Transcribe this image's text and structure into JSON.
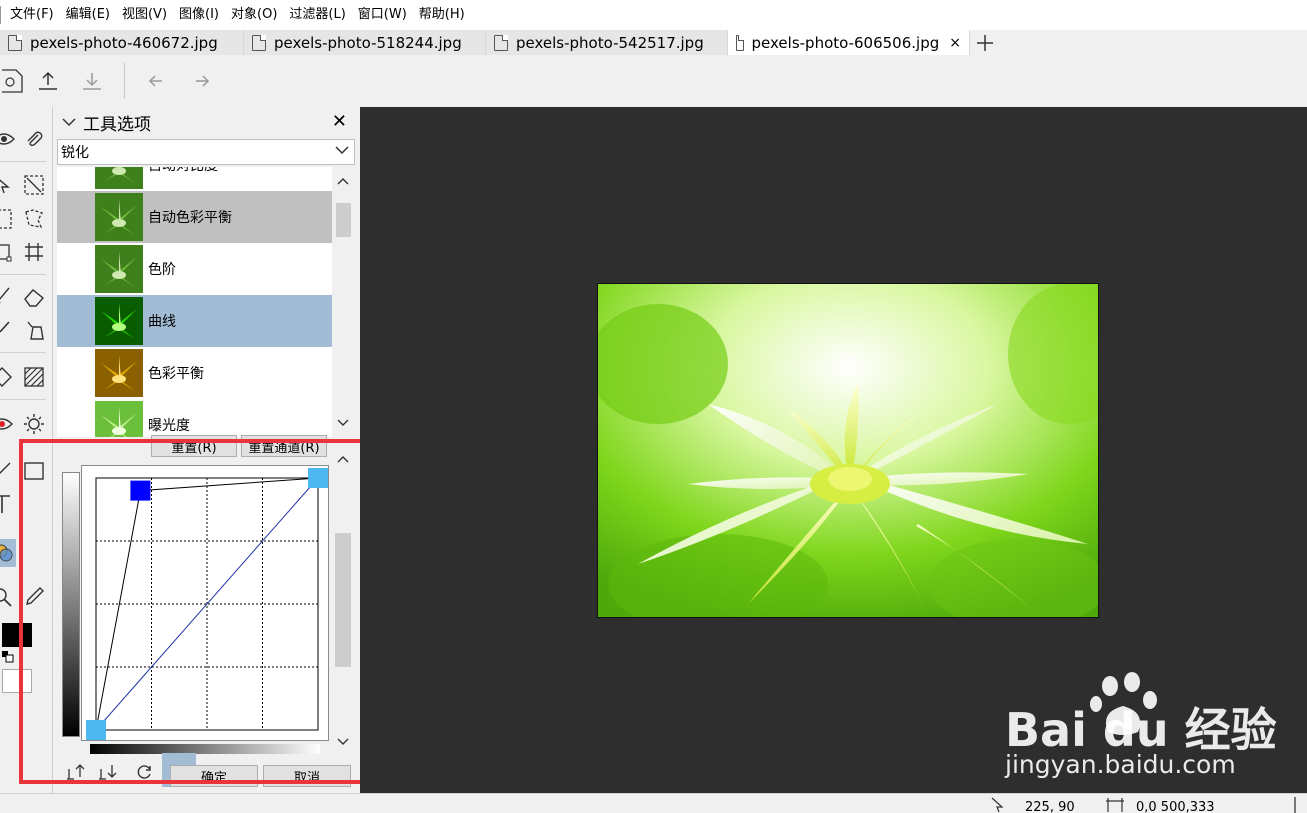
{
  "menu": [
    "文件(F)",
    "编辑(E)",
    "视图(V)",
    "图像(I)",
    "对象(O)",
    "过滤器(L)",
    "窗口(W)",
    "帮助(H)"
  ],
  "tabs": [
    {
      "label": "pexels-photo-460672.jpg"
    },
    {
      "label": "pexels-photo-518244.jpg"
    },
    {
      "label": "pexels-photo-542517.jpg"
    },
    {
      "label": "pexels-photo-606506.jpg",
      "active": true
    }
  ],
  "tab_close": "×",
  "panel": {
    "title": "工具选项",
    "close": "✕",
    "select_value": "锐化"
  },
  "presets": [
    {
      "label": "自动对比度",
      "tint": "normal"
    },
    {
      "label": "自动色彩平衡",
      "tint": "normal",
      "state": "hover"
    },
    {
      "label": "色阶",
      "tint": "normal"
    },
    {
      "label": "曲线",
      "tint": "vivid",
      "state": "selected"
    },
    {
      "label": "色彩平衡",
      "tint": "yellow"
    },
    {
      "label": "曝光度",
      "tint": "light"
    }
  ],
  "curves": {
    "reset_label": "重置(R)",
    "reset_channel_label": "重置通道(R)",
    "ok_label": "确定",
    "cancel_label": "取消",
    "points": [
      {
        "input": 0,
        "output": 0
      },
      {
        "input": 0.2,
        "output": 0.95
      },
      {
        "input": 1,
        "output": 1
      }
    ]
  },
  "status": {
    "cursor_pos": "225, 90",
    "selection": "0,0 500,333"
  },
  "watermark": {
    "logo_text": "Bai du 经验",
    "url": "jingyan.baidu.com"
  },
  "colors": {
    "accent_selected": "#a3bcd6",
    "highlight_box": "#e8343a",
    "canvas_bg": "#2e2e2e",
    "curve_handle_active": "#0000ff",
    "curve_handle": "#4db8f0"
  }
}
